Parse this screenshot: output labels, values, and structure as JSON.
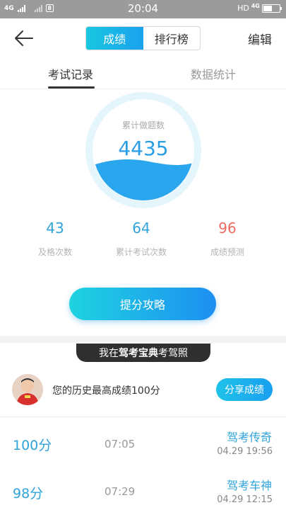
{
  "status_bar": {
    "network_left": "4G",
    "sim_label": "8",
    "time": "20:04",
    "hd": "HD",
    "network_right": "4G"
  },
  "nav": {
    "tab_scores": "成绩",
    "tab_ranking": "排行榜",
    "edit": "编辑"
  },
  "tabs": {
    "exam_records": "考试记录",
    "data_stats": "数据统计"
  },
  "gauge": {
    "label": "累计做题数",
    "value": "4435"
  },
  "stats": [
    {
      "value": "43",
      "label": "及格次数"
    },
    {
      "value": "64",
      "label": "累计考试次数"
    },
    {
      "value": "96",
      "label": "成绩预测"
    }
  ],
  "tips_button": "提分攻略",
  "banner": {
    "prefix": "我在",
    "brand": "驾考宝典",
    "suffix": "考驾照"
  },
  "best": {
    "text": "您的历史最高成绩100分",
    "share": "分享成绩"
  },
  "records": [
    {
      "score": "100分",
      "duration": "07:05",
      "title": "驾考传奇",
      "date": "04.29  19:56"
    },
    {
      "score": "98分",
      "duration": "07:29",
      "title": "驾考车神",
      "date": "04.29  12:15"
    }
  ],
  "colors": {
    "accent": "#2fa3da",
    "prediction": "#ee6a62",
    "gradient_start": "#1ed3e0",
    "gradient_end": "#1d8ff2"
  }
}
